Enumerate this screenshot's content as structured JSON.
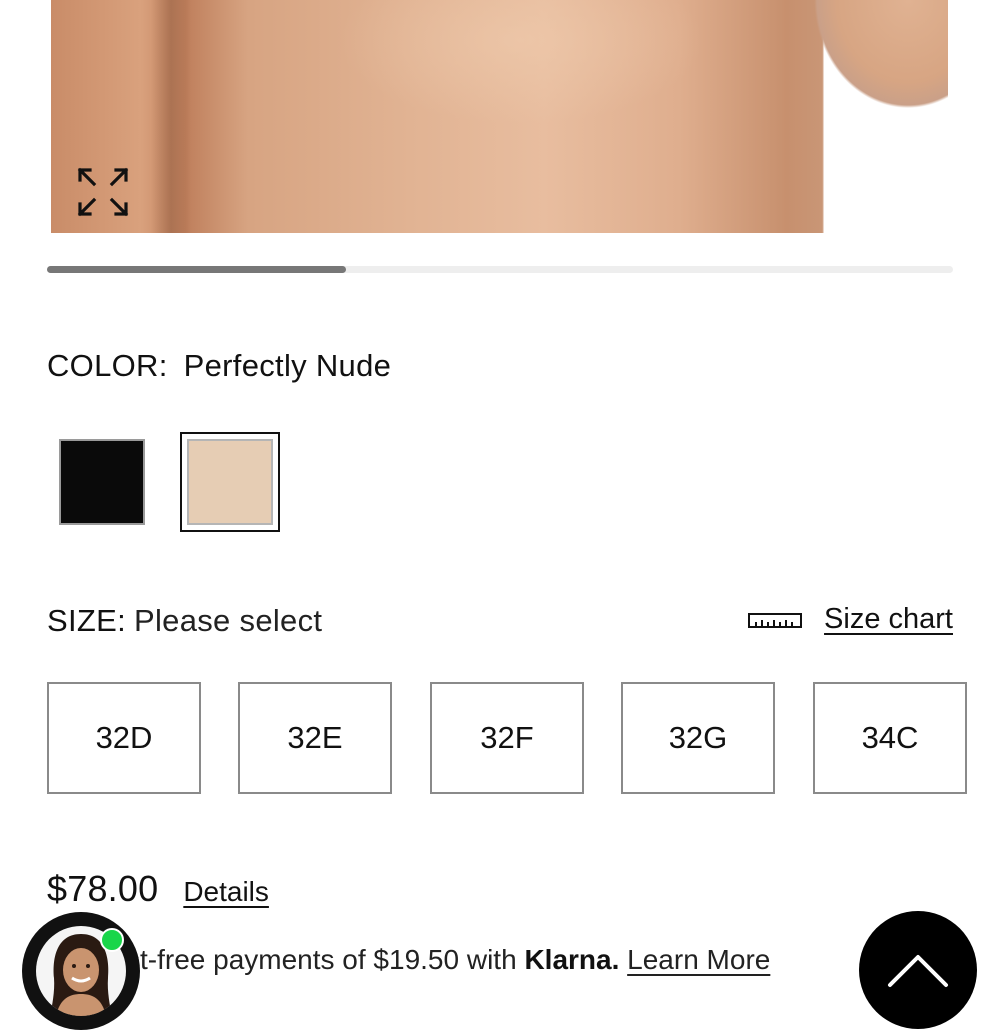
{
  "gallery": {
    "image_alt": "",
    "expand_icon": "expand-arrows-icon",
    "scroll_progress": 0.33
  },
  "color": {
    "label": "COLOR:",
    "selected": "Perfectly Nude",
    "swatches": [
      {
        "name": "Black",
        "hex": "#0a0a0a",
        "selected": false
      },
      {
        "name": "Perfectly Nude",
        "hex": "#e6cdb4",
        "selected": true
      }
    ]
  },
  "size": {
    "label": "SIZE:",
    "value": "Please select",
    "chart_label": "Size chart",
    "chart_icon": "ruler-icon",
    "options": [
      "32D",
      "32E",
      "32F",
      "32G",
      "34C"
    ]
  },
  "price": {
    "amount": "$78.00",
    "details_label": "Details"
  },
  "klarna": {
    "text": "st-free payments of $19.50 with",
    "brand": "Klarna.",
    "learn_more": "Learn More"
  },
  "chat": {
    "avatar_icon": "agent-avatar",
    "status_color": "#19d64a"
  },
  "back_to_top": {
    "icon": "chevron-up-icon"
  }
}
